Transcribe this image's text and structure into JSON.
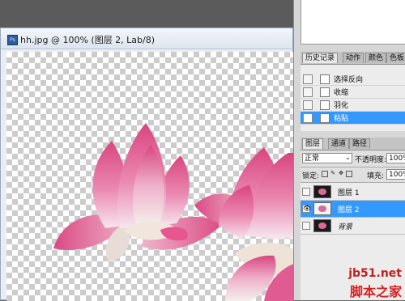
{
  "document": {
    "title": "hh.jpg @ 100% (图层 2, Lab/8)",
    "app_icon_text": "Ps"
  },
  "history_panel": {
    "tabs": [
      {
        "label": "历史记录",
        "active": true
      },
      {
        "label": "动作",
        "active": false
      },
      {
        "label": "颜色",
        "active": false
      },
      {
        "label": "色板",
        "active": false
      }
    ],
    "items": [
      {
        "label": "选择反向",
        "selected": false
      },
      {
        "label": "收缩",
        "selected": false
      },
      {
        "label": "羽化",
        "selected": false
      },
      {
        "label": "粘贴",
        "selected": true
      }
    ]
  },
  "layers_panel": {
    "tabs": [
      {
        "label": "图层",
        "active": true
      },
      {
        "label": "通道",
        "active": false
      },
      {
        "label": "路径",
        "active": false
      }
    ],
    "blend_mode": "正常",
    "opacity_label": "不透明度:",
    "opacity_value": "100%",
    "lock_label": "锁定:",
    "fill_label": "填充:",
    "fill_value": "100%",
    "layers": [
      {
        "name": "图层 1",
        "visible": false,
        "selected": false,
        "italic": false
      },
      {
        "name": "图层 2",
        "visible": true,
        "selected": true,
        "italic": false
      },
      {
        "name": "背景",
        "visible": false,
        "selected": false,
        "italic": true
      }
    ]
  },
  "watermark": {
    "site": "jb51.net",
    "name": "脚本之家"
  },
  "colors": {
    "selection": "#3399ff",
    "petal_pink": "#e2679a",
    "watermark_red": "#d42020"
  }
}
